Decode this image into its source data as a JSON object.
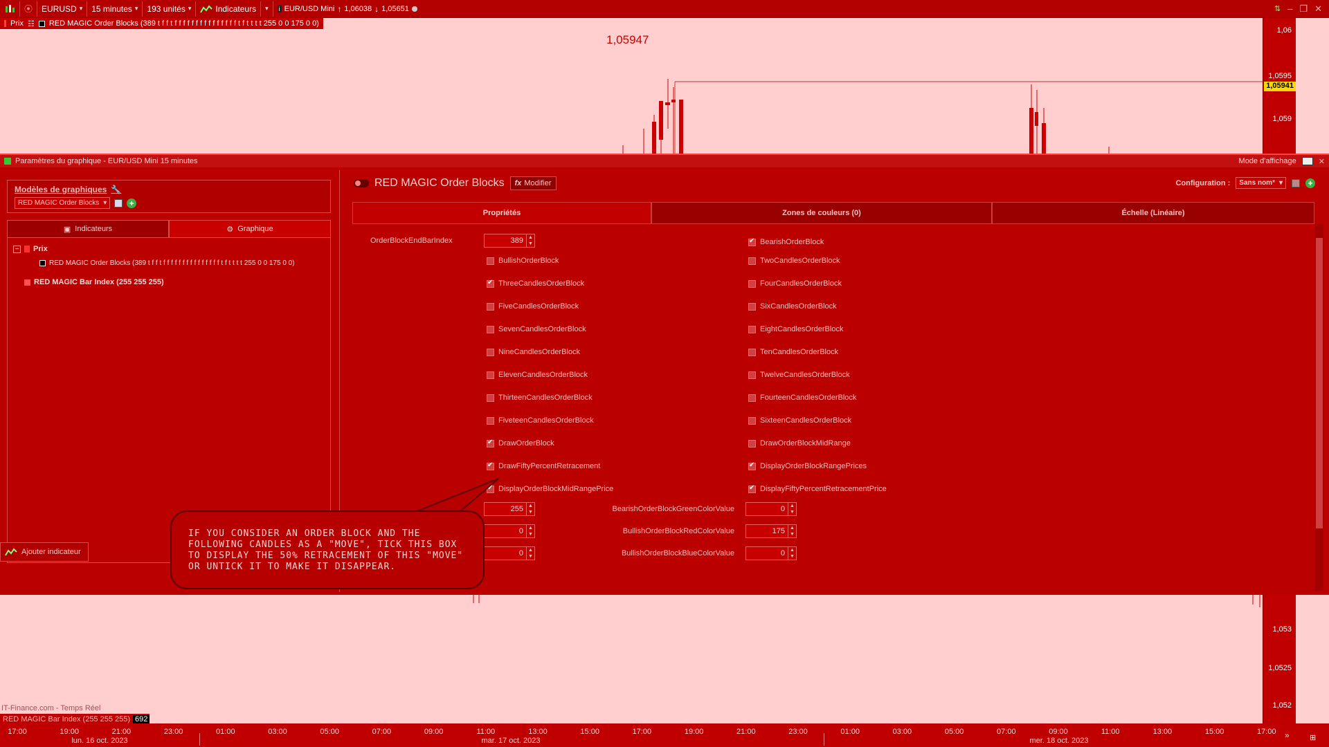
{
  "toolbar": {
    "symbol": "EURUSD",
    "timeframe": "15 minutes",
    "units": "193 unités",
    "indicators_label": "Indicateurs",
    "instrument": "EUR/USD Mini",
    "high": "1,06038",
    "low": "1,05651"
  },
  "chart_top": {
    "legend_prix": "Prix",
    "legend_indicator": "RED MAGIC Order Blocks (389 t f f t f f f f f f f f f f f f f f f t f t t t t 255 0 0 175 0 0)",
    "peak_label": "1,05947",
    "y_ticks": [
      "1,06",
      "1,0595",
      "1,059"
    ],
    "price_tag": "1,05941"
  },
  "dialog": {
    "title": "Paramètres du graphique - EUR/USD Mini 15 minutes",
    "display_mode": "Mode d'affichage",
    "models_title": "Modèles de graphiques",
    "models_select": "RED MAGIC Order Blocks",
    "tab_indicators": "Indicateurs",
    "tab_graph": "Graphique",
    "tree": {
      "prix": "Prix",
      "order_blocks": "RED MAGIC Order Blocks (389 t f f t f f f f f f f f f f f f f f f t f t t t t 255 0 0 175 0 0)",
      "bar_index": "RED MAGIC Bar Index (255 255 255)"
    },
    "add_indicator": "Ajouter indicateur",
    "indicator_name": "RED MAGIC Order Blocks",
    "modify": "Modifier",
    "config_label": "Configuration :",
    "config_value": "Sans nom*",
    "tabs": [
      "Propriétés",
      "Zones de couleurs (0)",
      "Échelle (Linéaire)"
    ]
  },
  "props_left": [
    {
      "label": "BullishOrderBlock",
      "checked": false
    },
    {
      "label": "ThreeCandlesOrderBlock",
      "checked": true
    },
    {
      "label": "FiveCandlesOrderBlock",
      "checked": false
    },
    {
      "label": "SevenCandlesOrderBlock",
      "checked": false
    },
    {
      "label": "NineCandlesOrderBlock",
      "checked": false
    },
    {
      "label": "ElevenCandlesOrderBlock",
      "checked": false
    },
    {
      "label": "ThirteenCandlesOrderBlock",
      "checked": false
    },
    {
      "label": "FiveteenCandlesOrderBlock",
      "checked": false
    },
    {
      "label": "DrawOrderBlock",
      "checked": true
    },
    {
      "label": "DrawFiftyPercentRetracement",
      "checked": true
    },
    {
      "label": "DisplayOrderBlockMidRangePrice",
      "checked": true
    }
  ],
  "props_right": [
    {
      "label": "BearishOrderBlock",
      "checked": true
    },
    {
      "label": "TwoCandlesOrderBlock",
      "checked": false
    },
    {
      "label": "FourCandlesOrderBlock",
      "checked": false
    },
    {
      "label": "SixCandlesOrderBlock",
      "checked": false
    },
    {
      "label": "EightCandlesOrderBlock",
      "checked": false
    },
    {
      "label": "TenCandlesOrderBlock",
      "checked": false
    },
    {
      "label": "TwelveCandlesOrderBlock",
      "checked": false
    },
    {
      "label": "FourteenCandlesOrderBlock",
      "checked": false
    },
    {
      "label": "SixteenCandlesOrderBlock",
      "checked": false
    },
    {
      "label": "DrawOrderBlockMidRange",
      "checked": false
    },
    {
      "label": "DisplayOrderBlockRangePrices",
      "checked": true
    },
    {
      "label": "DisplayFiftyPercentRetracementPrice",
      "checked": true
    }
  ],
  "numeric": {
    "end_bar_label": "OrderBlockEndBarIndex",
    "end_bar_value": "389",
    "left_values": [
      "255",
      "0",
      "0"
    ],
    "right": [
      {
        "label": "BearishOrderBlockGreenColorValue",
        "value": "0"
      },
      {
        "label": "BullishOrderBlockRedColorValue",
        "value": "175"
      },
      {
        "label": "BullishOrderBlockBlueColorValue",
        "value": "0"
      }
    ]
  },
  "callout": "IF YOU CONSIDER AN ORDER BLOCK AND THE FOLLOWING CANDLES AS A \"MOVE\", TICK THIS BOX TO DISPLAY THE 50% RETRACEMENT OF THIS \"MOVE\" OR UNTICK IT TO MAKE IT DISAPPEAR.",
  "chart_bottom": {
    "watermark": "IT-Finance.com - Temps Réel",
    "bar_index_label": "RED MAGIC Bar Index (255 255 255)",
    "bar_index_value": "692",
    "y_ticks": [
      "1,053",
      "1,0525",
      "1,052"
    ]
  },
  "xaxis": {
    "times": [
      "17:00",
      "19:00",
      "21:00",
      "23:00",
      "01:00",
      "03:00",
      "05:00",
      "07:00",
      "09:00",
      "11:00",
      "13:00",
      "15:00",
      "17:00",
      "19:00",
      "21:00",
      "23:00",
      "01:00",
      "03:00",
      "05:00",
      "07:00",
      "09:00",
      "11:00",
      "13:00",
      "15:00",
      "17:00"
    ],
    "dates": [
      "lun. 16 oct. 2023",
      "mar. 17 oct. 2023",
      "mer. 18 oct. 2023"
    ]
  },
  "colors": {
    "accent": "#b30000",
    "chart_bg": "#ffcfcf",
    "price_tag": "#ffd800",
    "candle": "#cc0000"
  }
}
